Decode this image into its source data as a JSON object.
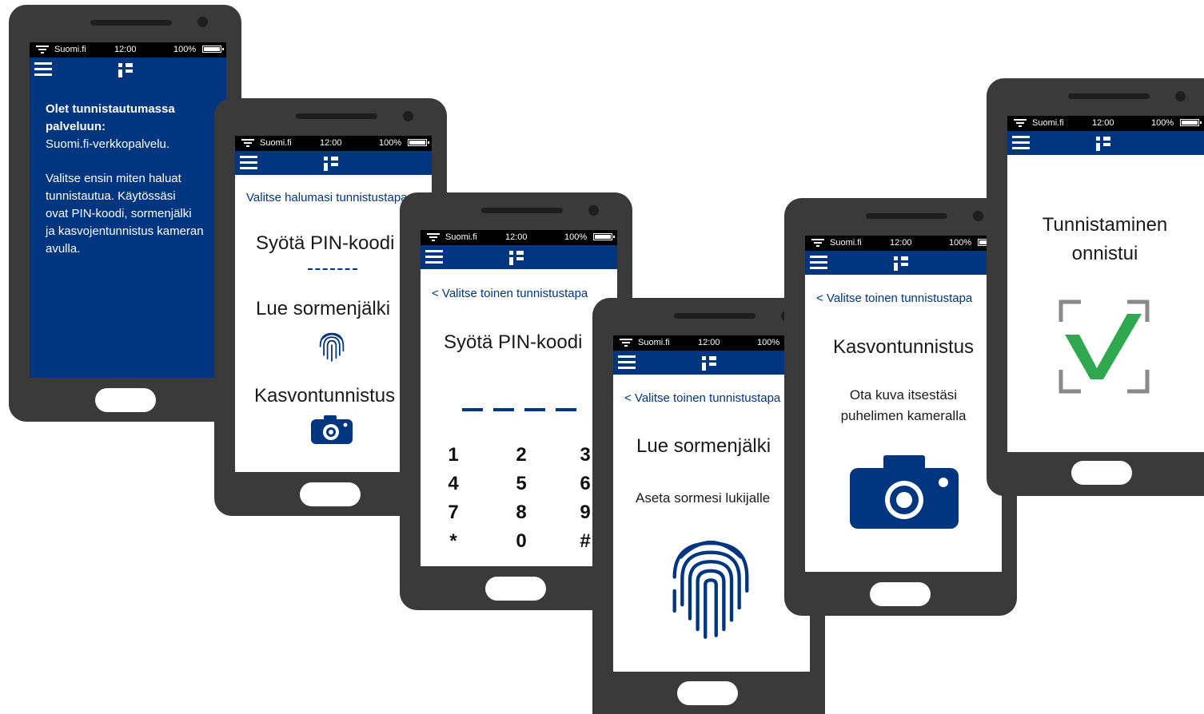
{
  "status": {
    "carrier": "Suomi.fi",
    "time": "12:00",
    "battery": "100%"
  },
  "screen1": {
    "heading_line1": "Olet tunnistautumassa",
    "heading_line2": "palveluun:",
    "service": "Suomi.fi-verkkopalvelu.",
    "body_line1": "Valitse ensin miten haluat",
    "body_line2": "tunnistautua. Käytössäsi",
    "body_line3": "ovat PIN-koodi, sormenjälki",
    "body_line4": "ja kasvojentunnistus kameran",
    "body_line5": "avulla."
  },
  "screen2": {
    "prompt": "Valitse halumasi tunnistustapa",
    "option_pin": "Syötä PIN-koodi",
    "option_fingerprint": "Lue sormenjälki",
    "option_face": "Kasvontunnistus"
  },
  "screen3": {
    "back_link": "< Valitse toinen tunnistustapa",
    "title": "Syötä PIN-koodi",
    "keys": [
      "1",
      "2",
      "3",
      "4",
      "5",
      "6",
      "7",
      "8",
      "9",
      "*",
      "0",
      "#"
    ]
  },
  "screen4": {
    "back_link": "< Valitse toinen tunnistustapa",
    "title": "Lue sormenjälki",
    "instruction": "Aseta sormesi lukijalle"
  },
  "screen5": {
    "back_link": "< Valitse toinen tunnistustapa",
    "title": "Kasvontunnistus",
    "instruction_line1": "Ota kuva itsestäsi",
    "instruction_line2": "puhelimen kameralla"
  },
  "screen6": {
    "title_line1": "Tunnistaminen",
    "title_line2": "onnistui"
  },
  "colors": {
    "brand_blue": "#003580",
    "success_green": "#2fa84f",
    "frame_gray": "#8a8a8a"
  }
}
